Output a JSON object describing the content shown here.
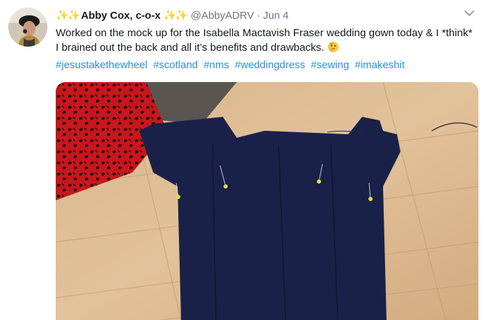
{
  "tweet": {
    "author": {
      "display_name": "Abby Cox, c-o-x",
      "handle": "@AbbyADRV",
      "avatar_alt": "profile photo"
    },
    "name_emoji_left": "✨✨",
    "name_emoji_right": "✨✨",
    "separator": "·",
    "date": "Jun 4",
    "text": "Worked on the mock up for the Isabella Mactavish Fraser wedding gown today & I *think* I brained out the back and all it’s benefits and drawbacks.",
    "trailing_emoji": "thinking-face",
    "hashtags": [
      "#jesustakethewheel",
      "#scotland",
      "#nms",
      "#weddingdress",
      "#sewing",
      "#imakeshit"
    ],
    "menu_icon": "chevron-down-icon",
    "media_description_icon": "photo"
  },
  "colors": {
    "link": "#1b95e0",
    "secondary_text": "#657786",
    "primary_text": "#14171a",
    "sparkle": "#f4b400"
  }
}
